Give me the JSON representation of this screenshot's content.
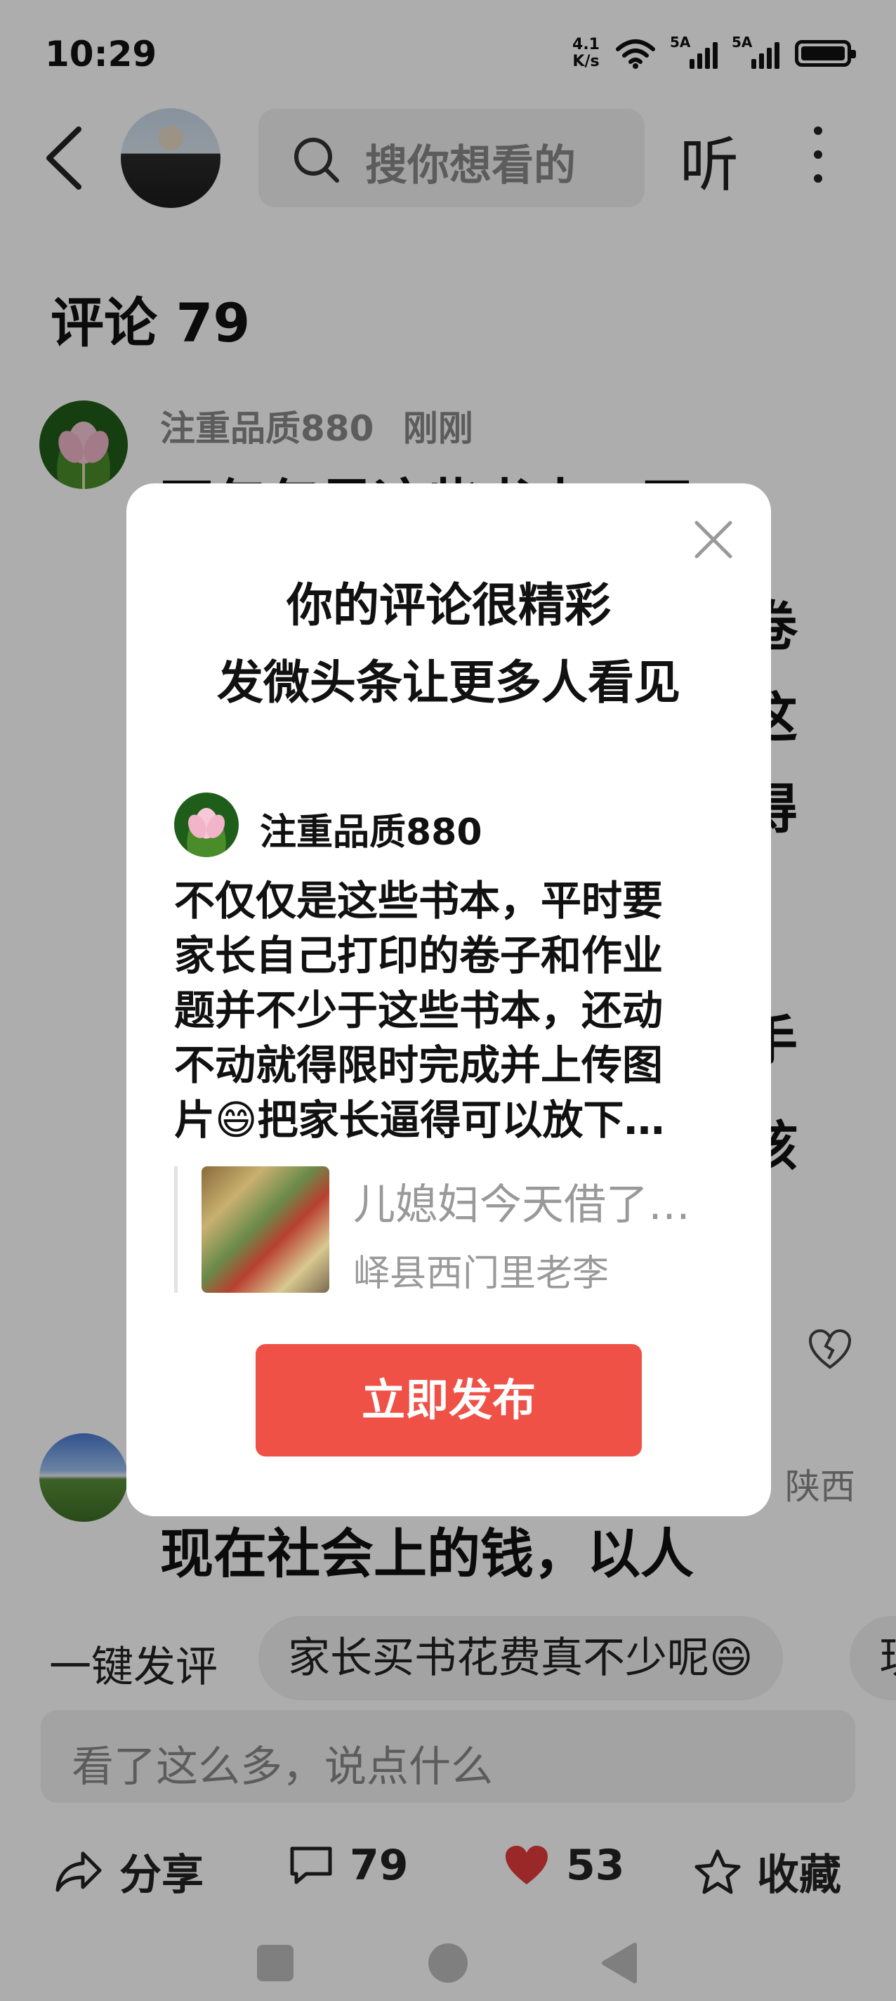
{
  "status_bar": {
    "time": "10:29",
    "net_speed_value": "4.1",
    "net_speed_unit": "K/s",
    "signal1_label": "5A",
    "signal2_label": "5A"
  },
  "header": {
    "search_placeholder": "搜你想看的",
    "listen_label": "听"
  },
  "comments": {
    "title": "评论 79",
    "items": [
      {
        "user": "注重品质880",
        "time": "刚刚",
        "text_line1": "不仅仅是这些书本，平"
      },
      {
        "region": "陕西",
        "text_line1": "现在社会上的钱，以人"
      }
    ],
    "side_fragments": [
      "卷",
      "这",
      "得",
      "手",
      "孩"
    ]
  },
  "quick_comments": {
    "label": "一键发评",
    "chips": [
      "家长买书花费真不少呢😄",
      "现"
    ]
  },
  "comment_input": {
    "placeholder": "看了这么多，说点什么"
  },
  "actions": {
    "share": "分享",
    "comments_count": "79",
    "likes_count": "53",
    "favorite": "收藏"
  },
  "modal": {
    "title_line1": "你的评论很精彩",
    "title_line2": "发微头条让更多人看见",
    "user": "注重品质880",
    "comment_lines": [
      "不仅仅是这些书本，平时要",
      "家长自己打印的卷子和作业",
      "题并不少于这些书本，还动",
      "不动就得限时完成并上传图",
      "片😄把家长逼得可以放下…"
    ],
    "quote_title": "儿媳妇今天借了…",
    "quote_author": "峄县西门里老李",
    "publish_label": "立即发布"
  },
  "colors": {
    "accent": "#ef5147",
    "like_heart": "#e33b3b"
  },
  "icons": [
    "back-arrow-icon",
    "search-icon",
    "more-icon",
    "close-icon",
    "share-icon",
    "comment-icon",
    "heart-icon",
    "star-icon",
    "broken-heart-icon"
  ]
}
